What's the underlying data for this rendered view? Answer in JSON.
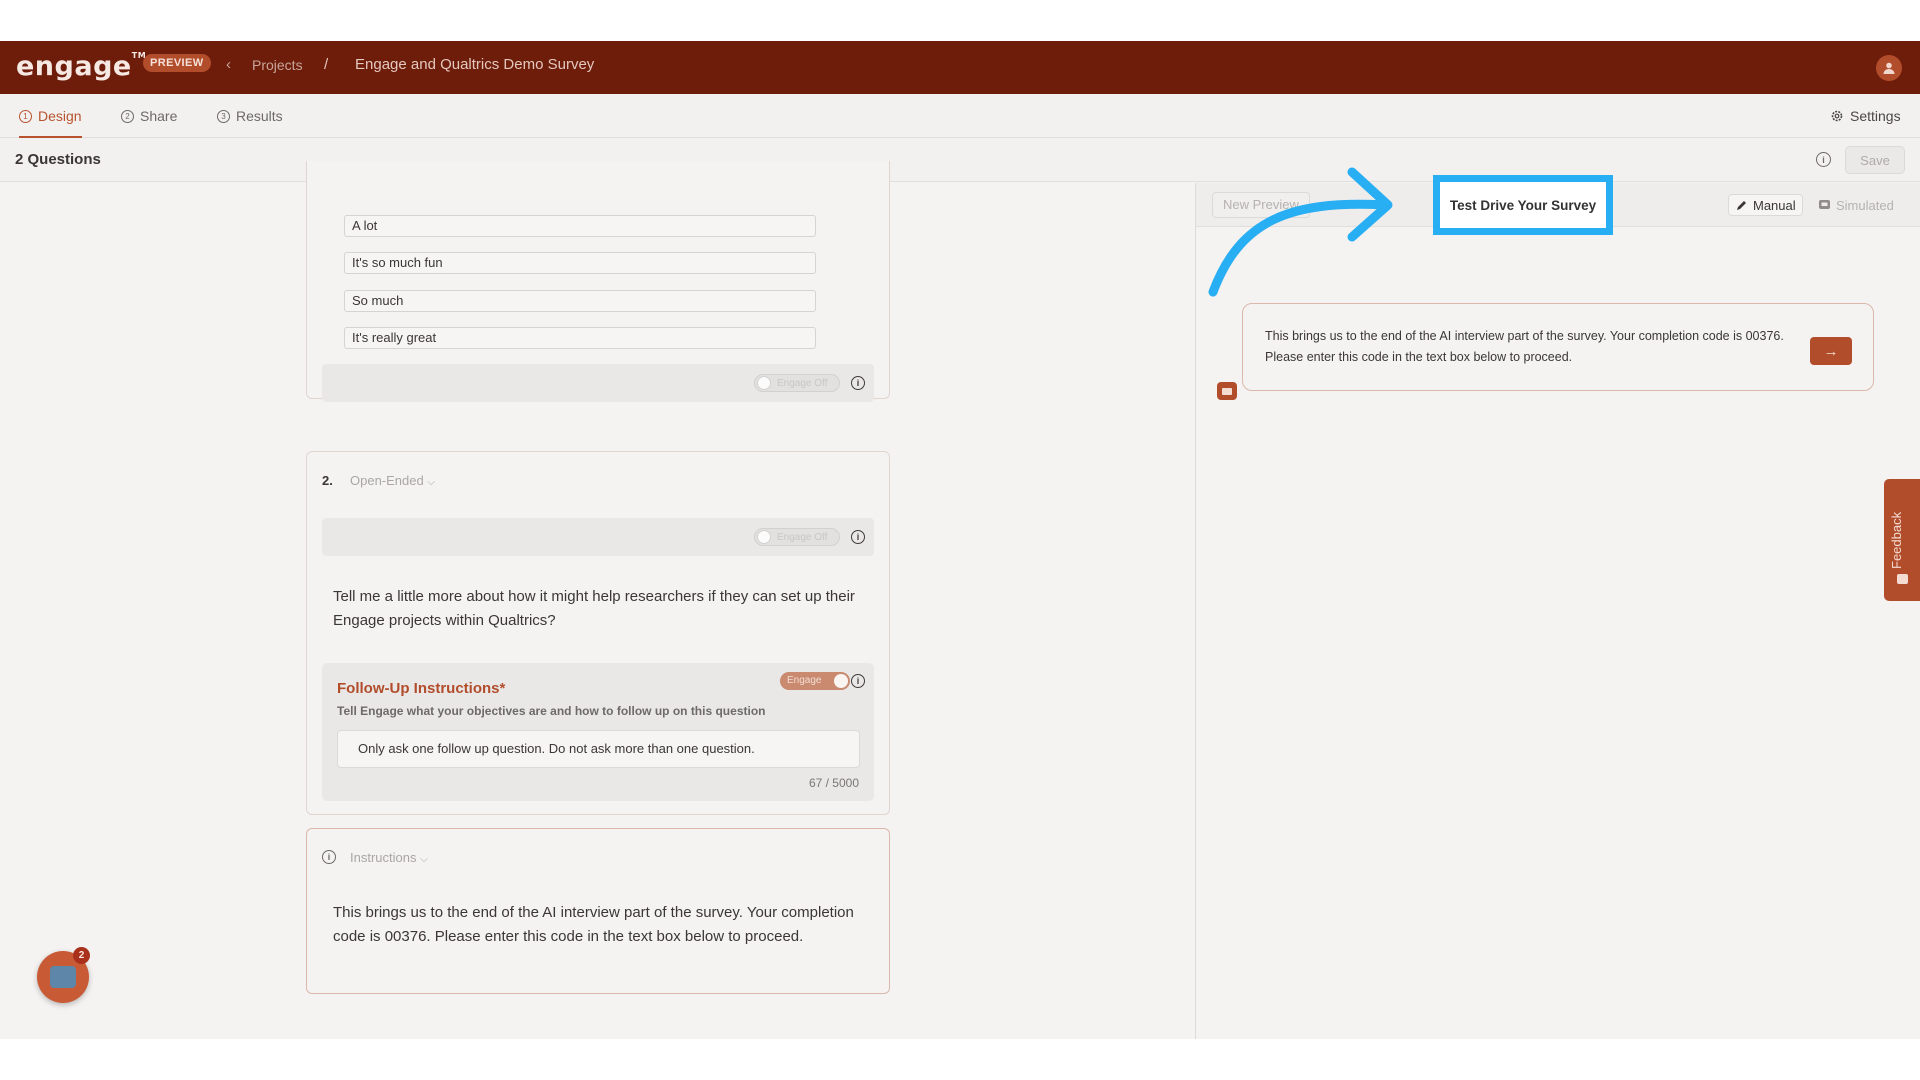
{
  "header": {
    "logo_text": "engage",
    "logo_tm": "TM",
    "preview_badge": "PREVIEW",
    "back_glyph": "‹",
    "crumb_projects": "Projects",
    "crumb_separator": "/",
    "project_title": "Engage and Qualtrics Demo Survey"
  },
  "tabs": [
    {
      "label": "Design",
      "num": "1"
    },
    {
      "label": "Share",
      "num": "2"
    },
    {
      "label": "Results",
      "num": "3"
    }
  ],
  "settings_label": "Settings",
  "subheader": {
    "question_count": "2 Questions",
    "save_label": "Save"
  },
  "question1": {
    "options": [
      "A lot",
      "It's so much fun",
      "So much",
      "It's really great"
    ],
    "engage_toggle": "Engage Off"
  },
  "question2": {
    "number": "2.",
    "type": "Open-Ended",
    "engage_toggle": "Engage Off",
    "text": "Tell me a little more about how it might help researchers if they can set up their Engage projects within Qualtrics?",
    "followup_title": "Follow-Up Instructions*",
    "followup_subtitle": "Tell Engage what your objectives are and how to follow up on this question",
    "followup_toggle": "Engage",
    "followup_value": "Only ask one follow up question. Do not ask more than one question.",
    "followup_count": "67 / 5000"
  },
  "instructions": {
    "type": "Instructions",
    "text": "This brings us to the end of the AI interview part of the survey. Your completion code is 00376. Please enter this code in the text box below to proceed."
  },
  "preview": {
    "new_preview": "New Preview",
    "manual_label": "Manual",
    "simulated_label": "Simulated",
    "chat_message": "This brings us to the end of the AI interview part of the survey. Your completion code is 00376. Please enter this code in the text box below to proceed.",
    "send_glyph": "→"
  },
  "feedback_label": "Feedback",
  "chat_launcher_badge": "2",
  "tutorial_callout": "Test Drive Your Survey",
  "colors": {
    "brand_dark": "#6e1d0b",
    "accent": "#b24d2c",
    "highlight": "#28aef2"
  }
}
